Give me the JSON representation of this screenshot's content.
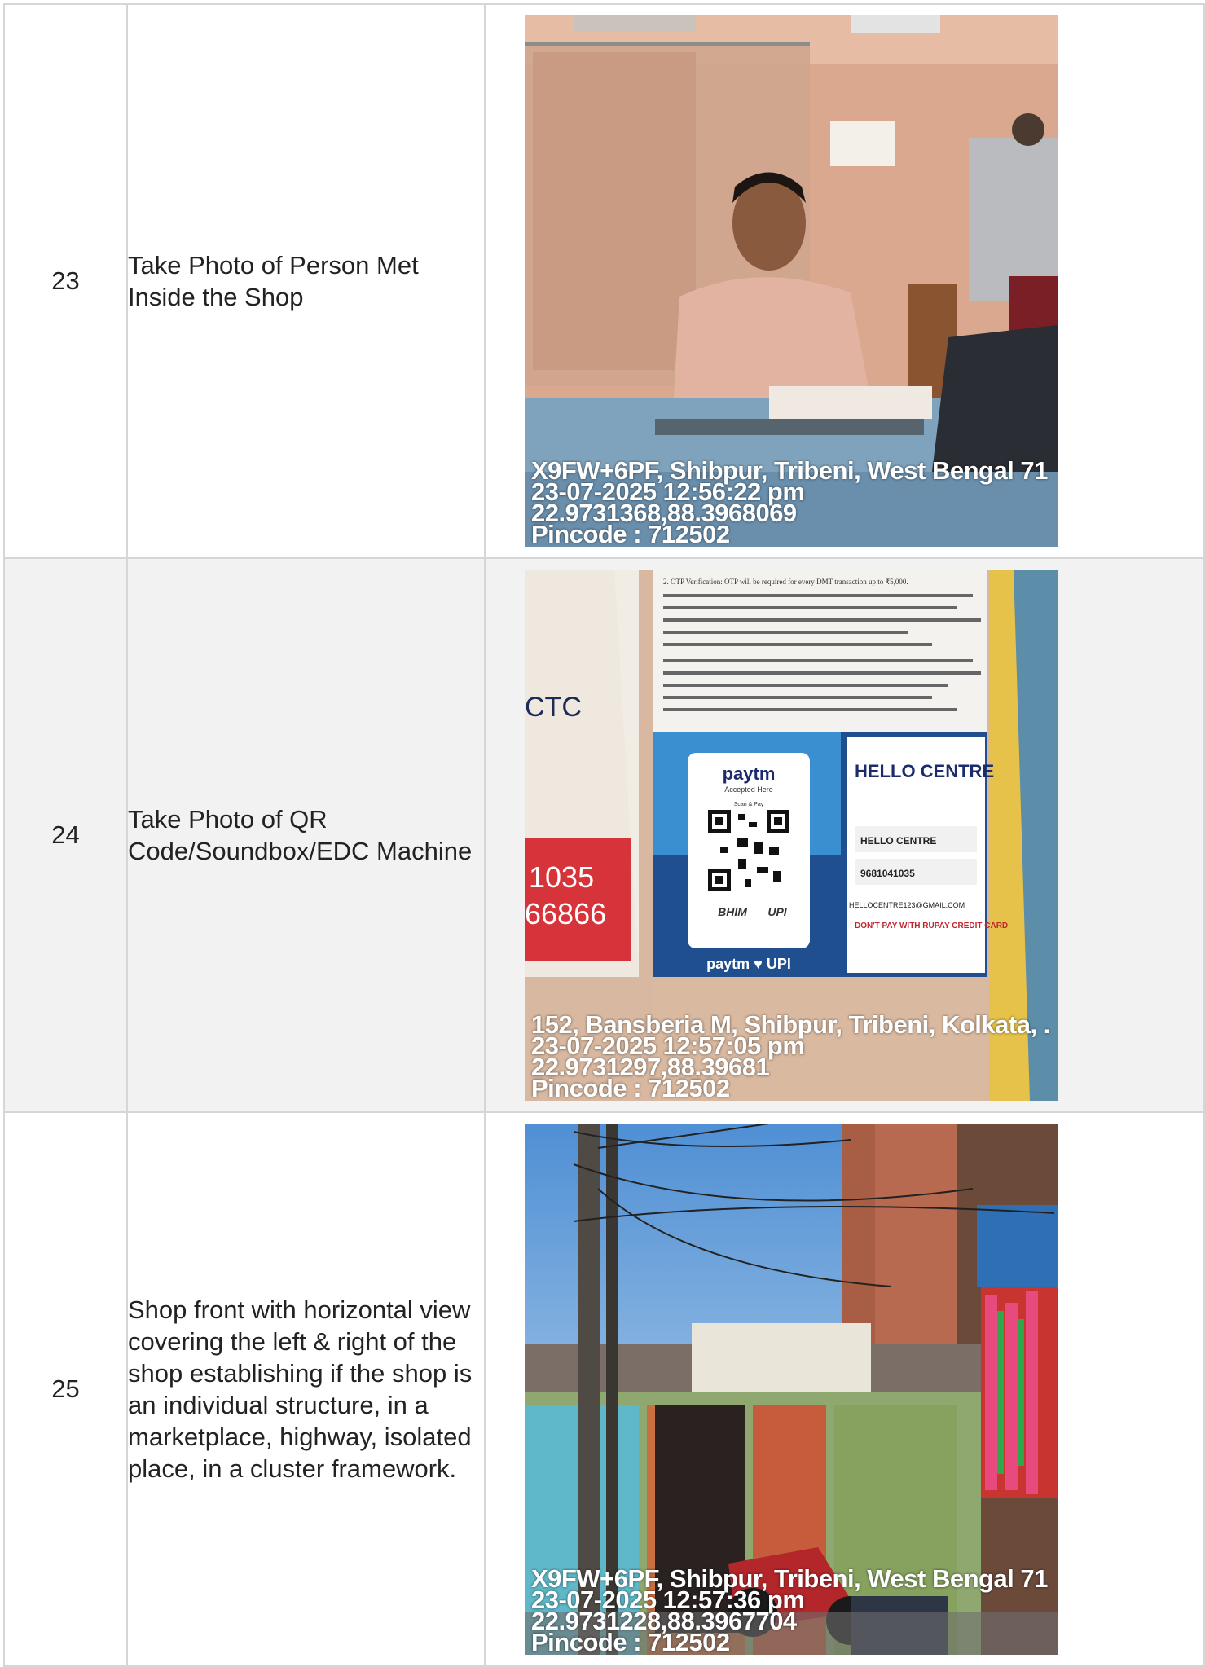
{
  "rows": [
    {
      "number": "23",
      "description": "Take Photo of Person Met Inside the Shop",
      "photo": {
        "icon": "shop-person-photo",
        "stamp": [
          "X9FW+6PF, Shibpur, Tribeni, West Bengal 71",
          "23-07-2025 12:56:22 pm",
          "22.9731368,88.3968069",
          "Pincode : 712502"
        ]
      }
    },
    {
      "number": "24",
      "description": "Take Photo of QR Code/Soundbox/EDC Machine",
      "photo": {
        "icon": "qr-code-poster-photo",
        "poster_brand": "paytm",
        "poster_accepted": "Accepted Here",
        "poster_scan": "Scan & Pay",
        "poster_bhim": "BHIM",
        "poster_upi": "UPI",
        "poster_footer": "paytm ♥ UPI",
        "centre_logo": "HELLO CENTRE",
        "centre_name": "HELLO CENTRE",
        "centre_phone": "9681041035",
        "centre_email": "HELLOCENTRE123@GMAIL.COM",
        "centre_warning": "DON'T PAY WITH RUPAY CREDIT CARD",
        "notice_line1": "2. OTP Verification: OTP will be required for every DMT transaction up to ₹5,000.",
        "side_numbers": [
          "1035",
          "66866"
        ],
        "side_text": "CTC",
        "stamp": [
          "152, Bansberia M, Shibpur, Tribeni, Kolkata, .",
          "23-07-2025 12:57:05 pm",
          "22.9731297,88.39681",
          "Pincode : 712502"
        ]
      }
    },
    {
      "number": "25",
      "description": "Shop front with horizontal view covering the left & right of the shop establishing if the shop is an individual structure, in a marketplace, highway, isolated place, in a cluster framework.",
      "photo": {
        "icon": "shop-front-photo",
        "stamp": [
          "X9FW+6PF, Shibpur, Tribeni, West Bengal 71",
          "23-07-2025 12:57:36 pm",
          "22.9731228,88.3967704",
          "Pincode : 712502"
        ]
      }
    }
  ]
}
